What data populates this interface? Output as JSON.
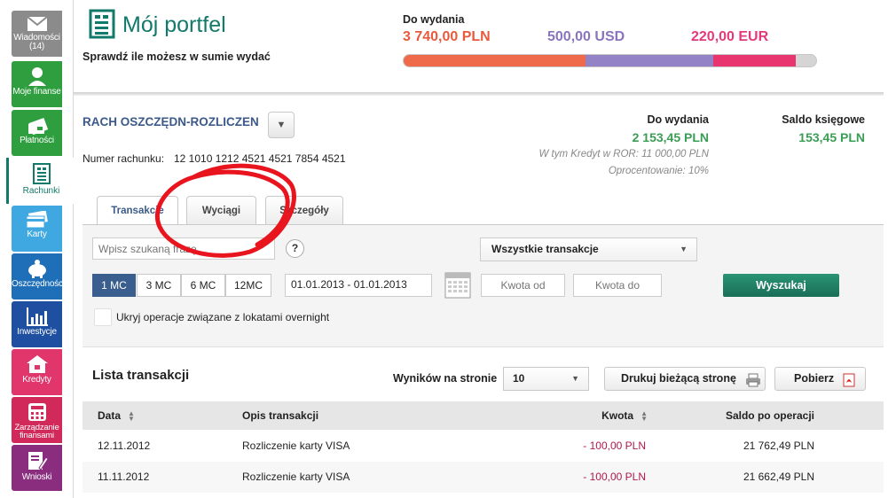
{
  "sidebar": {
    "items": [
      {
        "label": "Wiadomości",
        "sub": "(14)",
        "icon": "envelope-icon",
        "color": "#8b8b8b"
      },
      {
        "label": "Moje finanse",
        "icon": "person-icon",
        "color": "#2f9e3f"
      },
      {
        "label": "Płatności",
        "icon": "wallet-icon",
        "color": "#2f9e3f"
      },
      {
        "label": "Rachunki",
        "icon": "document-icon",
        "color": "#127a6a"
      },
      {
        "label": "Karty",
        "icon": "card-icon",
        "color": "#3fa8e0"
      },
      {
        "label": "Oszczędności",
        "icon": "piggy-bank-icon",
        "color": "#1f6fb8"
      },
      {
        "label": "Inwestycje",
        "icon": "chart-icon",
        "color": "#1f4fa0"
      },
      {
        "label": "Kredyty",
        "icon": "house-icon",
        "color": "#e0366b"
      },
      {
        "label": "Zarządzanie finansami",
        "icon": "calculator-icon",
        "color": "#d12a5a"
      },
      {
        "label": "Wnioski",
        "icon": "form-pen-icon",
        "color": "#8a2d7e"
      }
    ]
  },
  "header": {
    "title": "Mój portfel",
    "subtitle": "Sprawdź ile możesz w sumie wydać",
    "spend_label": "Do wydania",
    "amounts": [
      {
        "value": "3 740,00 PLN",
        "color": "#e8593d"
      },
      {
        "value": "500,00 USD",
        "color": "#8a74bd"
      },
      {
        "value": "220,00 EUR",
        "color": "#e33a7a"
      }
    ],
    "bar": [
      {
        "fraction": 0.44,
        "color": "#ef6a4a"
      },
      {
        "fraction": 0.31,
        "color": "#9482c6"
      },
      {
        "fraction": 0.2,
        "color": "#e8356f"
      }
    ]
  },
  "account": {
    "name": "RACH OSZCZĘDN-ROZLICZEN",
    "dropdown_icon": "chevron-down-icon",
    "number_label": "Numer rachunku:",
    "number": "12 1010 1212 4521 4521 7854 4521",
    "available_label": "Do wydania",
    "available_value": "2 153,45 PLN",
    "credit_text": "W tym Kredyt w ROR: 11 000,00 PLN",
    "rate_label": "Oprocentowanie:",
    "rate_value": "10%",
    "book_label": "Saldo księgowe",
    "book_value": "153,45 PLN"
  },
  "tabs": [
    "Transakcje",
    "Wyciągi",
    "Szczegóły"
  ],
  "filters": {
    "search_placeholder": "Wpisz szukaną frazę",
    "help_label": "?",
    "type_value": "Wszystkie transakcje",
    "periods": [
      "1 MC",
      "3 MC",
      "6 MC",
      "12MC"
    ],
    "date_range": "01.01.2013  - 01.01.2013",
    "amount_from_placeholder": "Kwota od",
    "amount_to_placeholder": "Kwota do",
    "search_button": "Wyszukaj",
    "overnight_label": "Ukryj operacje związane z lokatami overnight"
  },
  "list": {
    "title": "Lista transakcji",
    "per_page_label": "Wyników na stronie",
    "per_page_value": "10",
    "print_label": "Drukuj bieżącą stronę",
    "download_label": "Pobierz",
    "columns": {
      "date": "Data",
      "desc": "Opis transakcji",
      "amount": "Kwota",
      "balance": "Saldo po operacji"
    },
    "rows": [
      {
        "date": "12.11.2012",
        "desc": "Rozliczenie karty VISA",
        "amount": "- 100,00 PLN",
        "balance": "21 762,49 PLN"
      },
      {
        "date": "11.11.2012",
        "desc": "Rozliczenie karty VISA",
        "amount": "- 100,00 PLN",
        "balance": "21 662,49 PLN"
      }
    ]
  }
}
